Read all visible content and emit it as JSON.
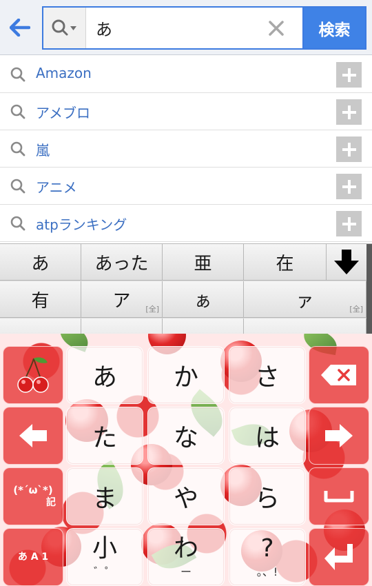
{
  "search": {
    "back_icon": "back-arrow-icon",
    "type_icon": "search-magnifier-dropdown-icon",
    "query": "あ",
    "clear_icon": "clear-x-icon",
    "submit_label": "検索"
  },
  "suggestions": [
    {
      "text": "Amazon"
    },
    {
      "text": "アメブロ"
    },
    {
      "text": "嵐"
    },
    {
      "text": "アニメ"
    },
    {
      "text": "atpランキング"
    }
  ],
  "candidates": {
    "row1": [
      "あ",
      "あった",
      "亜",
      "在"
    ],
    "row2": [
      "有",
      "ア",
      "ぁ",
      "ァ"
    ],
    "row2_sub": [
      "",
      "[全]",
      "",
      "[全]"
    ],
    "expand_icon": "down-arrow-icon"
  },
  "keyboard": {
    "keys": [
      "あ",
      "か",
      "さ",
      "た",
      "な",
      "は",
      "ま",
      "や",
      "ら",
      "小",
      "わ",
      "?"
    ],
    "small_sub": "゛゜",
    "wa_sub": "ー",
    "punct_sub": "。、!",
    "symbols_label": "(*´ω`*)",
    "symbols_sub": "記",
    "mode_label": "あ A 1",
    "fn_icons": [
      "cherry-logo-icon",
      "backspace-icon",
      "cursor-left-icon",
      "cursor-right-icon",
      "space-icon",
      "enter-icon"
    ]
  },
  "colors": {
    "accent_blue": "#3f82e6",
    "link_blue": "#3b6fc2",
    "key_red": "#e83c3c"
  }
}
